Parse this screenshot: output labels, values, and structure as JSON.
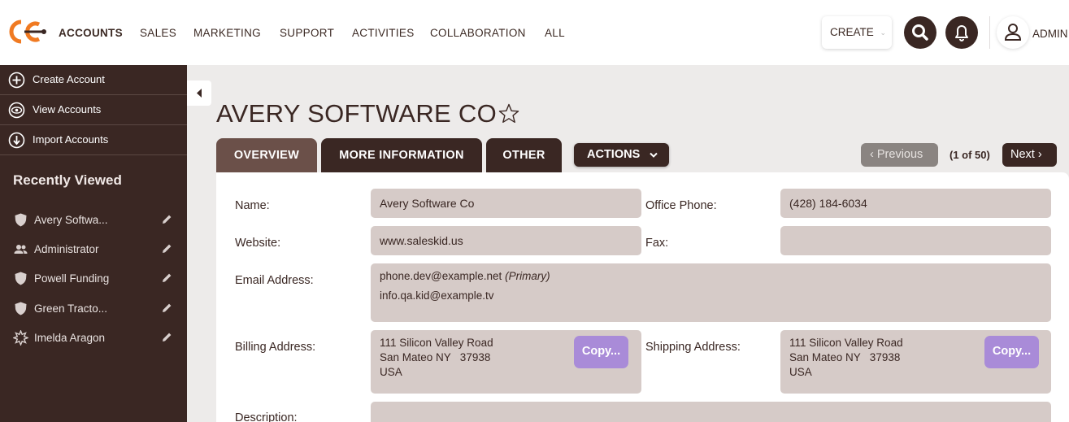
{
  "nav": {
    "items": [
      "ACCOUNTS",
      "SALES",
      "MARKETING",
      "SUPPORT",
      "ACTIVITIES",
      "COLLABORATION",
      "ALL"
    ],
    "create_label": "CREATE",
    "user_name": "ADMIN"
  },
  "sidebar": {
    "actions": [
      {
        "label": "Create Account",
        "icon": "plus-circle-icon"
      },
      {
        "label": "View Accounts",
        "icon": "eye-icon"
      },
      {
        "label": "Import Accounts",
        "icon": "download-circle-icon"
      }
    ],
    "recent_title": "Recently Viewed",
    "recent": [
      {
        "label": "Avery Softwa...",
        "icon": "shield-icon"
      },
      {
        "label": "Administrator",
        "icon": "users-icon"
      },
      {
        "label": "Powell Funding",
        "icon": "shield-icon"
      },
      {
        "label": "Green Tracto...",
        "icon": "shield-icon"
      },
      {
        "label": "Imelda Aragon",
        "icon": "starburst-icon"
      }
    ]
  },
  "record": {
    "title": "AVERY SOFTWARE CO"
  },
  "tabs": [
    "OVERVIEW",
    "MORE INFORMATION",
    "OTHER"
  ],
  "actions_label": "ACTIONS",
  "pagination": {
    "prev_label": "Previous",
    "position": "(1 of 50)",
    "next_label": "Next"
  },
  "fields": {
    "name_label": "Name:",
    "name_value": "Avery Software Co",
    "office_phone_label": "Office Phone:",
    "office_phone_value": "(428) 184-6034",
    "website_label": "Website:",
    "website_value": "www.saleskid.us",
    "fax_label": "Fax:",
    "fax_value": "",
    "email_label": "Email Address:",
    "email_primary": "phone.dev@example.net",
    "email_primary_tag": "(Primary)",
    "email_secondary": "info.qa.kid@example.tv",
    "billing_label": "Billing Address:",
    "billing_lines": [
      "111 Silicon Valley Road",
      "San Mateo NY   37938",
      "USA"
    ],
    "shipping_label": "Shipping Address:",
    "shipping_lines": [
      "111 Silicon Valley Road",
      "San Mateo NY   37938",
      "USA"
    ],
    "copy_label": "Copy...",
    "description_label": "Description:"
  },
  "colors": {
    "brand_dark": "#3a2723",
    "tab_active": "#6b5049",
    "field_bg": "#d6cbc8",
    "copy_button": "#a98bd8",
    "logo_orange": "#f07a22"
  }
}
